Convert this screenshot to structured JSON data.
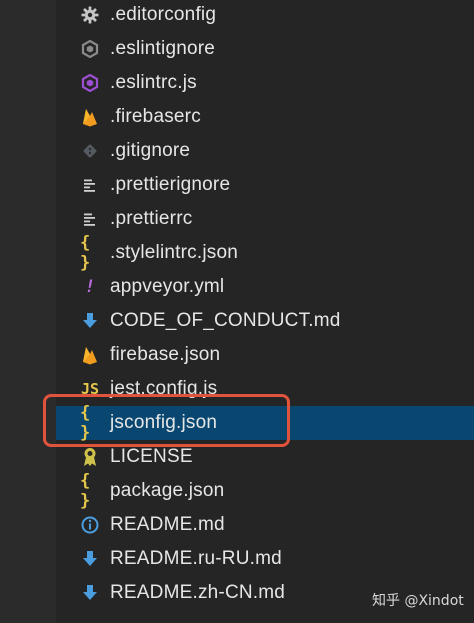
{
  "colors": {
    "background": "#252526",
    "selection": "#094771",
    "highlight_box": "#e0533c",
    "text": "#e6e6e6"
  },
  "files": [
    {
      "name": ".editorconfig",
      "icon": "gear-icon",
      "color": "#c5c5c5"
    },
    {
      "name": ".eslintignore",
      "icon": "eslint-icon-gray",
      "color": "#8a8a8a"
    },
    {
      "name": ".eslintrc.js",
      "icon": "eslint-icon",
      "color": "#9c4fd1"
    },
    {
      "name": ".firebaserc",
      "icon": "firebase-icon",
      "color": "#f29c1f"
    },
    {
      "name": ".gitignore",
      "icon": "git-icon",
      "color": "#555a60"
    },
    {
      "name": ".prettierignore",
      "icon": "lines-icon",
      "color": "#d0d0d0"
    },
    {
      "name": ".prettierrc",
      "icon": "lines-icon",
      "color": "#d0d0d0"
    },
    {
      "name": ".stylelintrc.json",
      "icon": "braces-icon",
      "glyph": "{ }",
      "color": "#e3c64b"
    },
    {
      "name": "appveyor.yml",
      "icon": "exclamation-icon",
      "glyph": "!",
      "color": "#b66ad6"
    },
    {
      "name": "CODE_OF_CONDUCT.md",
      "icon": "download-arrow-icon",
      "color": "#4a9ee0"
    },
    {
      "name": "firebase.json",
      "icon": "firebase-icon",
      "color": "#f29c1f"
    },
    {
      "name": "jest.config.js",
      "icon": "js-icon",
      "glyph": "JS",
      "color": "#e3c64b"
    },
    {
      "name": "jsconfig.json",
      "icon": "braces-icon",
      "glyph": "{ }",
      "color": "#e3c64b",
      "selected": true
    },
    {
      "name": "LICENSE",
      "icon": "ribbon-icon",
      "color": "#cfc24a"
    },
    {
      "name": "package.json",
      "icon": "braces-icon",
      "glyph": "{ }",
      "color": "#e3c64b"
    },
    {
      "name": "README.md",
      "icon": "info-icon",
      "color": "#4a9ee0"
    },
    {
      "name": "README.ru-RU.md",
      "icon": "download-arrow-icon",
      "color": "#4a9ee0"
    },
    {
      "name": "README.zh-CN.md",
      "icon": "download-arrow-icon",
      "color": "#4a9ee0"
    }
  ],
  "watermark": "知乎 @Xindot"
}
